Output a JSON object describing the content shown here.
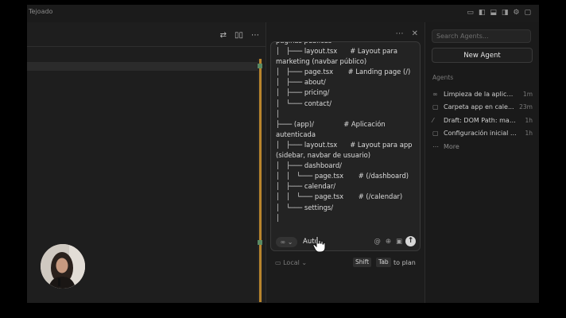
{
  "window": {
    "title": "Tejoado"
  },
  "editor": {
    "toolbar": [
      "⇄",
      "▯▯",
      "⋯"
    ]
  },
  "chat": {
    "header": [
      "⋯",
      "✕"
    ],
    "tree": [
      "páginas públicas",
      "│   ├─── layout.tsx      # Layout para",
      "marketing (navbar público)",
      "│   ├─── page.tsx       # Landing page (/)",
      "│   ├─── about/",
      "│   ├─── pricing/",
      "│   └─── contact/",
      "│",
      "├─── (app)/              # Aplicación",
      "autenticada",
      "│   ├─── layout.tsx      # Layout para app",
      "(sidebar, navbar de usuario)",
      "│   ├─── dashboard/",
      "│   │   └─── page.tsx       # (/dashboard)",
      "│   ├─── calendar/",
      "│   │   └─── page.tsx       # (/calendar)",
      "│   └─── settings/",
      "│"
    ],
    "mode_pill": "∞ ⌄",
    "mode": "Auto",
    "icons": [
      "@",
      "⊕",
      "▣"
    ],
    "send": "↑",
    "local": "▭ Local ⌄",
    "kbd_shift": "Shift",
    "kbd_tab": "Tab",
    "plan": "to plan"
  },
  "agents": {
    "search_placeholder": "Search Agents...",
    "new_agent": "New Agent",
    "section": "Agents",
    "items": [
      {
        "icon": "∞",
        "label": "Limpieza de la aplicaci...",
        "time": "1m"
      },
      {
        "icon": "▢",
        "label": "Carpeta app en cale...",
        "time": "23m"
      },
      {
        "icon": "⁄",
        "label": "Draft: DOM Path: main...",
        "time": "1h"
      },
      {
        "icon": "▢",
        "label": "Configuración inicial d...",
        "time": "1h"
      },
      {
        "icon": "⋯",
        "label": "More",
        "time": ""
      }
    ]
  }
}
